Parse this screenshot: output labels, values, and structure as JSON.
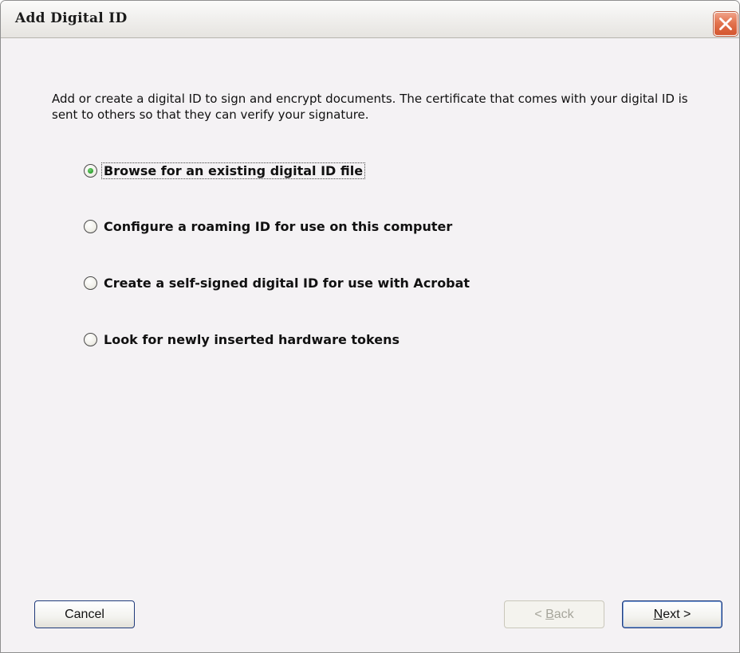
{
  "window": {
    "title": "Add Digital ID"
  },
  "description": "Add or create a digital ID to sign and encrypt documents. The certificate that comes with your digital ID is sent to others so that they can verify your signature.",
  "options": [
    {
      "label": "Browse for an existing digital ID file",
      "selected": true
    },
    {
      "label": "Configure a roaming ID for use on this computer",
      "selected": false
    },
    {
      "label": "Create a self-signed digital ID for use with Acrobat",
      "selected": false
    },
    {
      "label": "Look for newly inserted hardware tokens",
      "selected": false
    }
  ],
  "buttons": {
    "cancel": "Cancel",
    "back_prefix": "< ",
    "back_mnemonic": "B",
    "back_rest": "ack",
    "next_mnemonic": "N",
    "next_rest": "ext >"
  },
  "colors": {
    "titlebar": "#efeee9",
    "close_button": "#e3744f",
    "dialog_background": "#f4f2f4",
    "selected_radio": "#2f9e2f"
  },
  "icons": {
    "close": "close-icon"
  }
}
